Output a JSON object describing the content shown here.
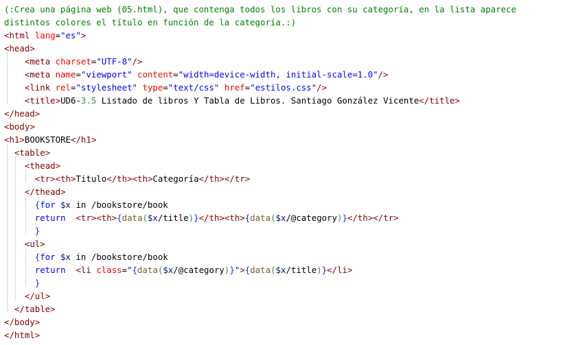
{
  "code_lines": [
    [
      {
        "t": "(:Crea una página web (05.html), que contenga todos los libros con su categoría, en la lista aparece",
        "c": "cm"
      }
    ],
    [
      {
        "t": "distintos colores el título en función de la categoría.:)",
        "c": "cm"
      }
    ],
    [
      {
        "t": "<",
        "c": "tag"
      },
      {
        "t": "html",
        "c": "tag"
      },
      {
        "t": " ",
        "c": "txt"
      },
      {
        "t": "lang",
        "c": "attr"
      },
      {
        "t": "=",
        "c": "txt"
      },
      {
        "t": "\"es\"",
        "c": "str"
      },
      {
        "t": ">",
        "c": "tag"
      }
    ],
    [
      {
        "t": "<",
        "c": "tag"
      },
      {
        "t": "head",
        "c": "tag"
      },
      {
        "t": ">",
        "c": "tag"
      }
    ],
    [
      {
        "t": "    ",
        "c": "txt"
      },
      {
        "t": "<",
        "c": "tag"
      },
      {
        "t": "meta",
        "c": "tag"
      },
      {
        "t": " ",
        "c": "txt"
      },
      {
        "t": "charset",
        "c": "attr"
      },
      {
        "t": "=",
        "c": "txt"
      },
      {
        "t": "\"UTF-8\"",
        "c": "str"
      },
      {
        "t": "/>",
        "c": "tag"
      }
    ],
    [
      {
        "t": "    ",
        "c": "txt"
      },
      {
        "t": "<",
        "c": "tag"
      },
      {
        "t": "meta",
        "c": "tag"
      },
      {
        "t": " ",
        "c": "txt"
      },
      {
        "t": "name",
        "c": "attr"
      },
      {
        "t": "=",
        "c": "txt"
      },
      {
        "t": "\"viewport\"",
        "c": "str"
      },
      {
        "t": " ",
        "c": "txt"
      },
      {
        "t": "content",
        "c": "attr"
      },
      {
        "t": "=",
        "c": "txt"
      },
      {
        "t": "\"width=device-width, initial-scale=1.0\"",
        "c": "str"
      },
      {
        "t": "/>",
        "c": "tag"
      }
    ],
    [
      {
        "t": "    ",
        "c": "txt"
      },
      {
        "t": "<",
        "c": "tag"
      },
      {
        "t": "link",
        "c": "tag"
      },
      {
        "t": " ",
        "c": "txt"
      },
      {
        "t": "rel",
        "c": "attr"
      },
      {
        "t": "=",
        "c": "txt"
      },
      {
        "t": "\"stylesheet\"",
        "c": "str"
      },
      {
        "t": " ",
        "c": "txt"
      },
      {
        "t": "type",
        "c": "attr"
      },
      {
        "t": "=",
        "c": "txt"
      },
      {
        "t": "\"text/css\"",
        "c": "str"
      },
      {
        "t": " ",
        "c": "txt"
      },
      {
        "t": "href",
        "c": "attr"
      },
      {
        "t": "=",
        "c": "txt"
      },
      {
        "t": "\"estilos.css\"",
        "c": "str"
      },
      {
        "t": "/>",
        "c": "tag"
      }
    ],
    [
      {
        "t": "    ",
        "c": "txt"
      },
      {
        "t": "<",
        "c": "tag"
      },
      {
        "t": "title",
        "c": "tag"
      },
      {
        "t": ">",
        "c": "tag"
      },
      {
        "t": "UD6-",
        "c": "txt"
      },
      {
        "t": "3.5",
        "c": "br2"
      },
      {
        "t": " Listado de libros Y Tabla de Libros. Santiago González Vicente",
        "c": "txt"
      },
      {
        "t": "</",
        "c": "tag"
      },
      {
        "t": "title",
        "c": "tag"
      },
      {
        "t": ">",
        "c": "tag"
      }
    ],
    [
      {
        "t": "</",
        "c": "tag"
      },
      {
        "t": "head",
        "c": "tag"
      },
      {
        "t": ">",
        "c": "tag"
      }
    ],
    [
      {
        "t": "<",
        "c": "tag"
      },
      {
        "t": "body",
        "c": "tag"
      },
      {
        "t": ">",
        "c": "tag"
      }
    ],
    [
      {
        "t": "<",
        "c": "tag"
      },
      {
        "t": "h1",
        "c": "tag"
      },
      {
        "t": ">",
        "c": "tag"
      },
      {
        "t": "BOOKSTORE",
        "c": "txt"
      },
      {
        "t": "</",
        "c": "tag"
      },
      {
        "t": "h1",
        "c": "tag"
      },
      {
        "t": ">",
        "c": "tag"
      }
    ],
    [
      {
        "t": "  ",
        "c": "txt"
      },
      {
        "t": "<",
        "c": "tag"
      },
      {
        "t": "table",
        "c": "tag"
      },
      {
        "t": ">",
        "c": "tag"
      }
    ],
    [
      {
        "t": "    ",
        "c": "txt"
      },
      {
        "t": "<",
        "c": "tag"
      },
      {
        "t": "thead",
        "c": "tag"
      },
      {
        "t": ">",
        "c": "tag"
      }
    ],
    [
      {
        "t": "      ",
        "c": "txt"
      },
      {
        "t": "<",
        "c": "tag"
      },
      {
        "t": "tr",
        "c": "tag"
      },
      {
        "t": ">",
        "c": "tag"
      },
      {
        "t": "<",
        "c": "tag"
      },
      {
        "t": "th",
        "c": "tag"
      },
      {
        "t": ">",
        "c": "tag"
      },
      {
        "t": "Titulo",
        "c": "txt"
      },
      {
        "t": "</",
        "c": "tag"
      },
      {
        "t": "th",
        "c": "tag"
      },
      {
        "t": ">",
        "c": "tag"
      },
      {
        "t": "<",
        "c": "tag"
      },
      {
        "t": "th",
        "c": "tag"
      },
      {
        "t": ">",
        "c": "tag"
      },
      {
        "t": "Categoría",
        "c": "txt"
      },
      {
        "t": "</",
        "c": "tag"
      },
      {
        "t": "th",
        "c": "tag"
      },
      {
        "t": ">",
        "c": "tag"
      },
      {
        "t": "</",
        "c": "tag"
      },
      {
        "t": "tr",
        "c": "tag"
      },
      {
        "t": ">",
        "c": "tag"
      }
    ],
    [
      {
        "t": "    ",
        "c": "txt"
      },
      {
        "t": "</",
        "c": "tag"
      },
      {
        "t": "thead",
        "c": "tag"
      },
      {
        "t": ">",
        "c": "tag"
      }
    ],
    [
      {
        "t": "      ",
        "c": "txt"
      },
      {
        "t": "{",
        "c": "br"
      },
      {
        "t": "for",
        "c": "kw"
      },
      {
        "t": " ",
        "c": "txt"
      },
      {
        "t": "$x",
        "c": "var"
      },
      {
        "t": " in /bookstore/book",
        "c": "txt"
      }
    ],
    [
      {
        "t": "      ",
        "c": "txt"
      },
      {
        "t": "return",
        "c": "kw"
      },
      {
        "t": "  ",
        "c": "txt"
      },
      {
        "t": "<",
        "c": "tag"
      },
      {
        "t": "tr",
        "c": "tag"
      },
      {
        "t": ">",
        "c": "tag"
      },
      {
        "t": "<",
        "c": "tag"
      },
      {
        "t": "th",
        "c": "tag"
      },
      {
        "t": ">",
        "c": "tag"
      },
      {
        "t": "{",
        "c": "br"
      },
      {
        "t": "data",
        "c": "fn"
      },
      {
        "t": "(",
        "c": "br2"
      },
      {
        "t": "$x",
        "c": "var"
      },
      {
        "t": "/title",
        "c": "txt"
      },
      {
        "t": ")",
        "c": "br2"
      },
      {
        "t": "}",
        "c": "br"
      },
      {
        "t": "</",
        "c": "tag"
      },
      {
        "t": "th",
        "c": "tag"
      },
      {
        "t": ">",
        "c": "tag"
      },
      {
        "t": "<",
        "c": "tag"
      },
      {
        "t": "th",
        "c": "tag"
      },
      {
        "t": ">",
        "c": "tag"
      },
      {
        "t": "{",
        "c": "br"
      },
      {
        "t": "data",
        "c": "fn"
      },
      {
        "t": "(",
        "c": "br2"
      },
      {
        "t": "$x",
        "c": "var"
      },
      {
        "t": "/@category",
        "c": "txt"
      },
      {
        "t": ")",
        "c": "br2"
      },
      {
        "t": "}",
        "c": "br"
      },
      {
        "t": "</",
        "c": "tag"
      },
      {
        "t": "th",
        "c": "tag"
      },
      {
        "t": ">",
        "c": "tag"
      },
      {
        "t": "</",
        "c": "tag"
      },
      {
        "t": "tr",
        "c": "tag"
      },
      {
        "t": ">",
        "c": "tag"
      }
    ],
    [
      {
        "t": "      ",
        "c": "txt"
      },
      {
        "t": "}",
        "c": "br"
      }
    ],
    [
      {
        "t": "    ",
        "c": "txt"
      },
      {
        "t": "<",
        "c": "tag"
      },
      {
        "t": "ul",
        "c": "tag"
      },
      {
        "t": ">",
        "c": "tag"
      }
    ],
    [
      {
        "t": "      ",
        "c": "txt"
      },
      {
        "t": "{",
        "c": "br"
      },
      {
        "t": "for",
        "c": "kw"
      },
      {
        "t": " ",
        "c": "txt"
      },
      {
        "t": "$x",
        "c": "var"
      },
      {
        "t": " in /bookstore/book",
        "c": "txt"
      }
    ],
    [
      {
        "t": "      ",
        "c": "txt"
      },
      {
        "t": "return",
        "c": "kw"
      },
      {
        "t": "  ",
        "c": "txt"
      },
      {
        "t": "<",
        "c": "tag"
      },
      {
        "t": "li",
        "c": "tag"
      },
      {
        "t": " ",
        "c": "txt"
      },
      {
        "t": "class",
        "c": "attr"
      },
      {
        "t": "=",
        "c": "txt"
      },
      {
        "t": "\"",
        "c": "str"
      },
      {
        "t": "{",
        "c": "br"
      },
      {
        "t": "data",
        "c": "fn"
      },
      {
        "t": "(",
        "c": "br2"
      },
      {
        "t": "$x",
        "c": "var"
      },
      {
        "t": "/@category",
        "c": "txt"
      },
      {
        "t": ")",
        "c": "br2"
      },
      {
        "t": "}",
        "c": "br"
      },
      {
        "t": "\"",
        "c": "str"
      },
      {
        "t": ">",
        "c": "tag"
      },
      {
        "t": "{",
        "c": "br"
      },
      {
        "t": "data",
        "c": "fn"
      },
      {
        "t": "(",
        "c": "br2"
      },
      {
        "t": "$x",
        "c": "var"
      },
      {
        "t": "/title",
        "c": "txt"
      },
      {
        "t": ")",
        "c": "br2"
      },
      {
        "t": "}",
        "c": "br"
      },
      {
        "t": "</",
        "c": "tag"
      },
      {
        "t": "li",
        "c": "tag"
      },
      {
        "t": ">",
        "c": "tag"
      }
    ],
    [
      {
        "t": "      ",
        "c": "txt"
      },
      {
        "t": "}",
        "c": "br"
      }
    ],
    [
      {
        "t": "    ",
        "c": "txt"
      },
      {
        "t": "</",
        "c": "tag"
      },
      {
        "t": "ul",
        "c": "tag"
      },
      {
        "t": ">",
        "c": "tag"
      }
    ],
    [
      {
        "t": "  ",
        "c": "txt"
      },
      {
        "t": "</",
        "c": "tag"
      },
      {
        "t": "table",
        "c": "tag"
      },
      {
        "t": ">",
        "c": "tag"
      }
    ],
    [
      {
        "t": "</",
        "c": "tag"
      },
      {
        "t": "body",
        "c": "tag"
      },
      {
        "t": ">",
        "c": "tag"
      }
    ],
    [
      {
        "t": "</",
        "c": "tag"
      },
      {
        "t": "html",
        "c": "tag"
      },
      {
        "t": ">",
        "c": "tag"
      }
    ]
  ],
  "colors": {
    "comment": "#008000",
    "tag": "#800000",
    "attribute": "#ff0000",
    "string": "#0000ff",
    "keyword": "#0000ff",
    "variable": "#001080",
    "function": "#795e26",
    "background": "#ffffff",
    "indent_guide": "#d8d8d8"
  }
}
